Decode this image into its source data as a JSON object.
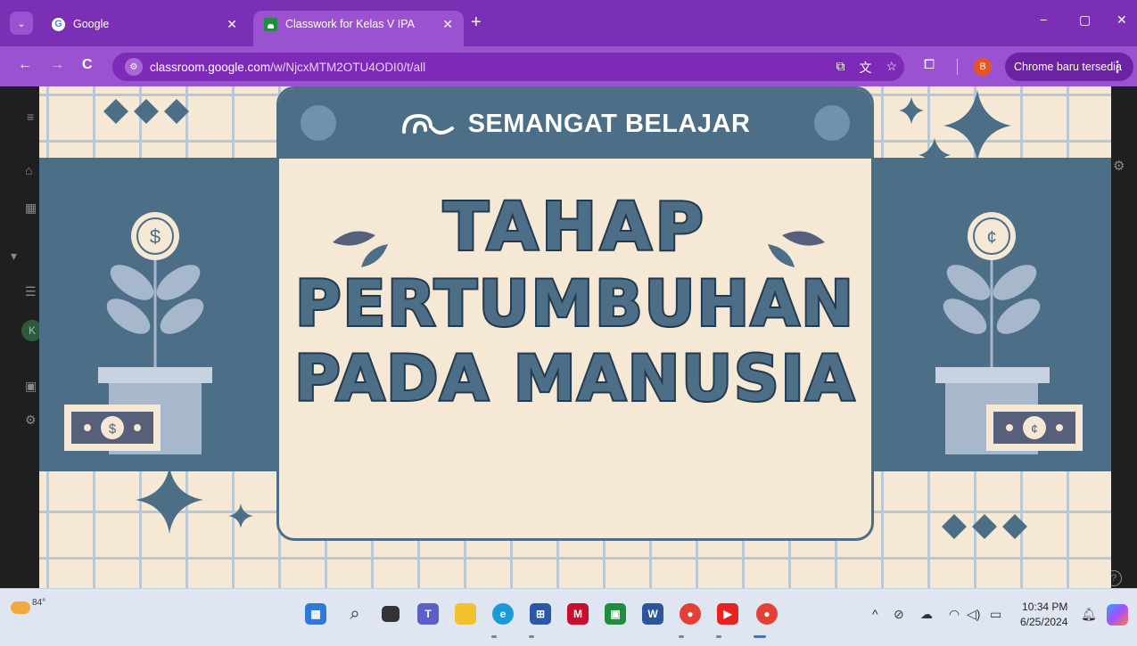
{
  "browser": {
    "tabs": [
      {
        "title": "Google",
        "favicon": "google-icon",
        "active": false
      },
      {
        "title": "Classwork for Kelas V IPA",
        "favicon": "classroom-icon",
        "active": true
      }
    ],
    "new_tab_label": "+",
    "window_controls": {
      "minimize": "−",
      "restore": "▢",
      "close": "✕"
    },
    "nav": {
      "back": "←",
      "forward": "→",
      "reload": "C"
    },
    "url_domain": "classroom.google.com",
    "url_path": "/w/NjcxMTM2OTU4ODI0/t/all",
    "profile_initial": "B",
    "update_button_label": "Chrome baru tersedia",
    "colors": {
      "tab_bg": "#7b2fb5",
      "toolbar_bg": "#9b52d1"
    }
  },
  "slide": {
    "header_text": "SEMANGAT BELAJAR",
    "title_lines": [
      "TAHAP",
      "PERTUMBUHAN",
      "PADA MANUSIA"
    ],
    "colors": {
      "background": "#f5e8d5",
      "accent": "#4c6e86",
      "grid": "#bcc7d5"
    }
  },
  "taskbar": {
    "weather_temp": "84°",
    "clock_time": "10:34 PM",
    "clock_date": "6/25/2024",
    "apps": [
      "windows-start-icon",
      "search-icon",
      "task-view-icon",
      "teams-icon",
      "file-explorer-icon",
      "edge-icon",
      "store-icon",
      "mcafee-icon",
      "classroom-icon",
      "word-icon",
      "chrome-icon",
      "youtube-icon",
      "chrome-profile-icon"
    ]
  }
}
